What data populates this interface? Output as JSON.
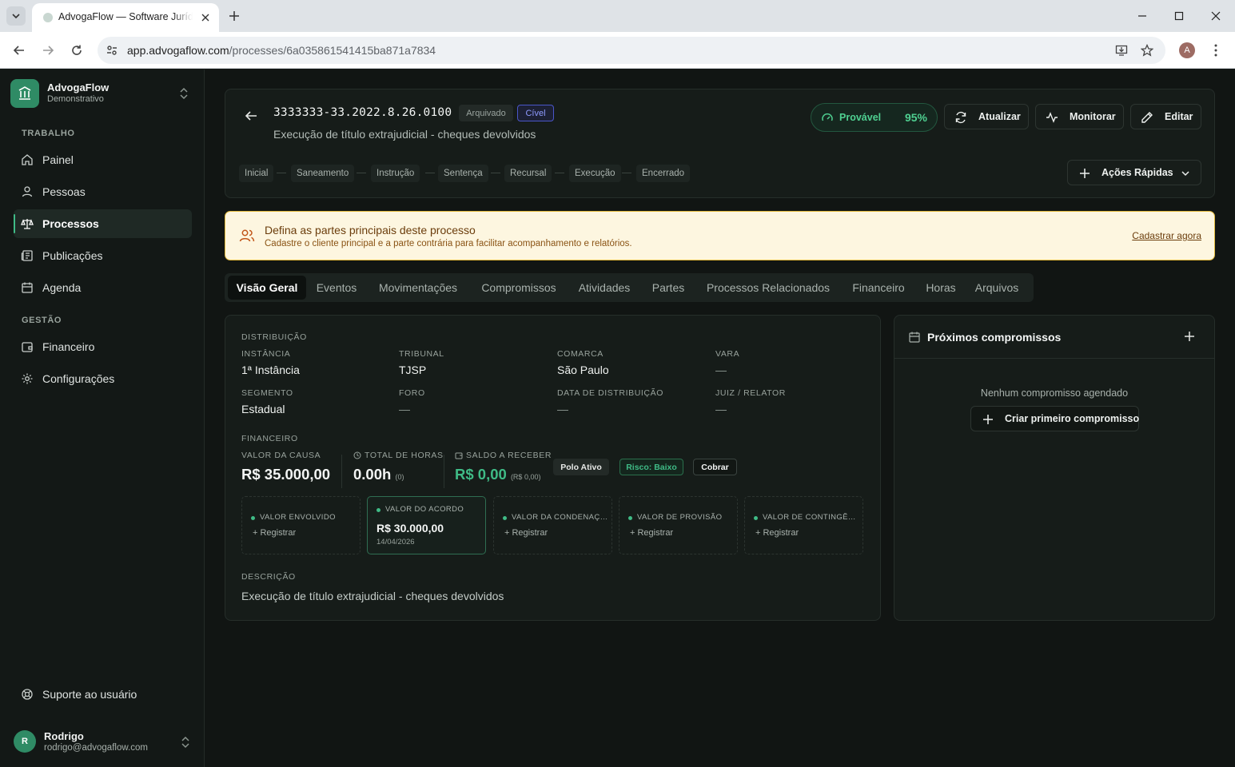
{
  "browser": {
    "tab_title": "AdvogaFlow — Software Jurídico",
    "url_host": "app.advogaflow.com",
    "url_path": "/processes/6a035861541415ba871a7834",
    "profile_initial": "A"
  },
  "sidebar": {
    "brand_name": "AdvogaFlow",
    "brand_sub": "Demonstrativo",
    "section_work": "TRABALHO",
    "section_manage": "GESTÃO",
    "items": [
      {
        "label": "Painel",
        "icon": "home-icon"
      },
      {
        "label": "Pessoas",
        "icon": "user-icon"
      },
      {
        "label": "Processos",
        "icon": "scale-icon",
        "active": true
      },
      {
        "label": "Publicações",
        "icon": "newspaper-icon"
      },
      {
        "label": "Agenda",
        "icon": "calendar-icon"
      },
      {
        "label": "Financeiro",
        "icon": "wallet-icon"
      },
      {
        "label": "Configurações",
        "icon": "gear-icon"
      }
    ],
    "support": "Suporte ao usuário",
    "user": {
      "initial": "R",
      "name": "Rodrigo",
      "email": "rodrigo@advogaflow.com"
    }
  },
  "header": {
    "process_number": "3333333-33.2022.8.26.0100",
    "badge_archived": "Arquivado",
    "badge_area": "Cível",
    "description": "Execução de título extrajudicial - cheques devolvidos",
    "probability_label": "Provável",
    "probability_value": "95%",
    "btn_refresh": "Atualizar",
    "btn_monitor": "Monitorar",
    "btn_edit": "Editar",
    "stages": [
      "Inicial",
      "Saneamento",
      "Instrução",
      "Sentença",
      "Recursal",
      "Execução",
      "Encerrado"
    ],
    "quick_actions": "Ações Rápidas"
  },
  "alert": {
    "title": "Defina as partes principais deste processo",
    "text": "Cadastre o cliente principal e a parte contrária para facilitar acompanhamento e relatórios.",
    "link": "Cadastrar agora"
  },
  "tabs": [
    "Visão Geral",
    "Eventos",
    "Movimentações",
    "Compromissos",
    "Atividades",
    "Partes",
    "Processos Relacionados",
    "Financeiro",
    "Horas",
    "Arquivos"
  ],
  "overview": {
    "distribution_label": "DISTRIBUIÇÃO",
    "fields": [
      {
        "label": "INSTÂNCIA",
        "value": "1ª Instância"
      },
      {
        "label": "TRIBUNAL",
        "value": "TJSP"
      },
      {
        "label": "COMARCA",
        "value": "São Paulo"
      },
      {
        "label": "VARA",
        "value": "—"
      },
      {
        "label": "SEGMENTO",
        "value": "Estadual"
      },
      {
        "label": "FORO",
        "value": "—"
      },
      {
        "label": "DATA DE DISTRIBUIÇÃO",
        "value": "—"
      },
      {
        "label": "JUIZ / RELATOR",
        "value": "—"
      }
    ],
    "financial_label": "FINANCEIRO",
    "cause_value_label": "VALOR DA CAUSA",
    "cause_value": "R$ 35.000,00",
    "hours_label": "TOTAL DE HORAS",
    "hours_value": "0.00h",
    "hours_count": "(0)",
    "balance_label": "SALDO A RECEBER",
    "balance_value": "R$ 0,00",
    "balance_sub": "(R$ 0,00)",
    "chip_pole": "Polo Ativo",
    "chip_risk": "Risco: Baixo",
    "chip_charge": "Cobrar",
    "value_boxes": [
      {
        "title": "VALOR ENVOLVIDO",
        "add": "+ Registrar"
      },
      {
        "title": "VALOR DO ACORDO",
        "amount": "R$ 30.000,00",
        "date": "14/04/2026"
      },
      {
        "title": "VALOR DA CONDENAÇÃO",
        "add": "+ Registrar"
      },
      {
        "title": "VALOR DE PROVISÃO",
        "add": "+ Registrar"
      },
      {
        "title": "VALOR DE CONTINGÊNCIA",
        "add": "+ Registrar"
      }
    ],
    "description_label": "DESCRIÇÃO",
    "description": "Execução de título extrajudicial - cheques devolvidos"
  },
  "events": {
    "title": "Próximos compromissos",
    "empty": "Nenhum compromisso agendado",
    "create_btn": "Criar primeiro compromisso"
  }
}
